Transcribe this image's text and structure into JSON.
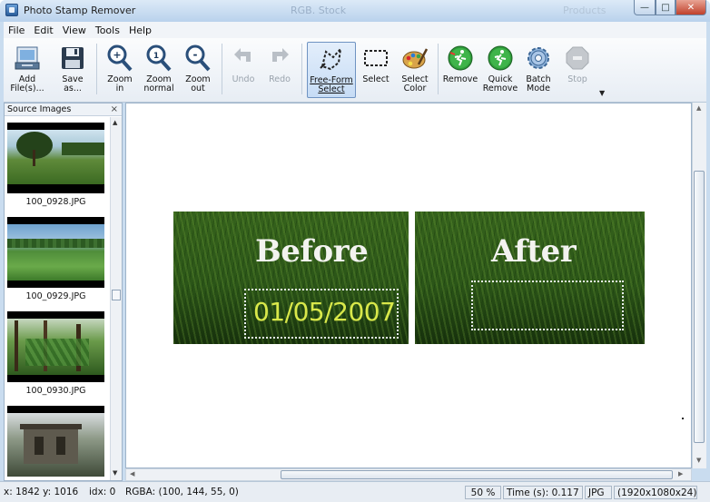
{
  "window": {
    "title": "Photo Stamp Remover",
    "title_ghost_center": "RGB. Stock",
    "title_ghost_right": "Products"
  },
  "menu": [
    "File",
    "Edit",
    "View",
    "Tools",
    "Help"
  ],
  "toolbar": {
    "add_files": "Add\nFile(s)...",
    "save_as": "Save\nas...",
    "zoom_in": "Zoom\nin",
    "zoom_normal": "Zoom\nnormal",
    "zoom_out": "Zoom\nout",
    "undo": "Undo",
    "redo": "Redo",
    "free_form_select": "Free-Form\nSelect",
    "select": "Select",
    "select_color": "Select\nColor",
    "remove": "Remove",
    "quick_remove": "Quick\nRemove",
    "batch_mode": "Batch\nMode",
    "stop": "Stop"
  },
  "source_panel": {
    "title": "Source Images",
    "close": "×",
    "items": [
      "100_0928.JPG",
      "100_0929.JPG",
      "100_0930.JPG"
    ]
  },
  "canvas": {
    "before_label": "Before",
    "after_label": "After",
    "date_stamp": "01/05/2007"
  },
  "status": {
    "coords": "x: 1842 y: 1016",
    "idx": "idx: 0",
    "rgba": "RGBA: (100, 144, 55, 0)",
    "zoom": "50 %",
    "time": "Time (s): 0.117",
    "format": "JPG",
    "dims": "(1920x1080x24)"
  }
}
